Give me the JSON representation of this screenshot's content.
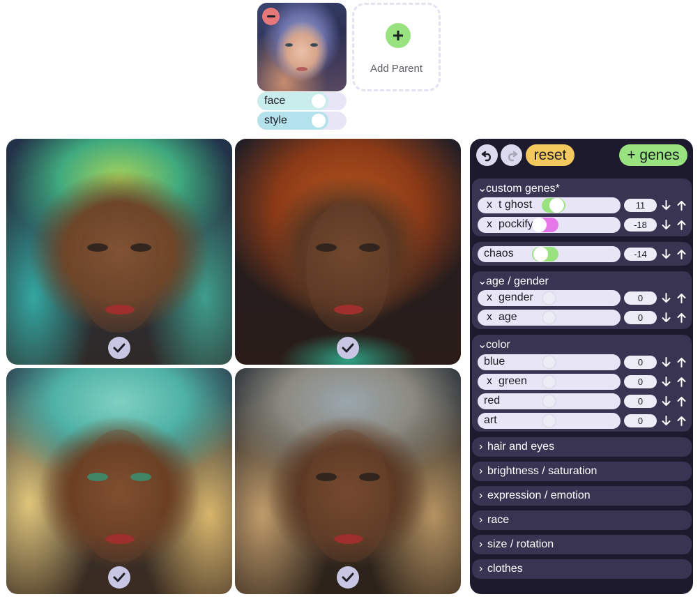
{
  "parent": {
    "add_label": "Add Parent",
    "sliders": [
      {
        "label": "face",
        "level": 0.8
      },
      {
        "label": "style",
        "level": 0.8
      }
    ]
  },
  "panel": {
    "reset_label": "reset",
    "genes_label": "+ genes",
    "groups": {
      "custom": {
        "title": "custom genes*",
        "rows": [
          {
            "x": "x",
            "name": "t ghost",
            "value": "11"
          },
          {
            "x": "x",
            "name": "pockify",
            "value": "-18"
          }
        ]
      },
      "chaos": {
        "name": "chaos",
        "value": "-14"
      },
      "age": {
        "title": "age / gender",
        "rows": [
          {
            "x": "x",
            "name": "gender",
            "value": "0"
          },
          {
            "x": "x",
            "name": "age",
            "value": "0"
          }
        ]
      },
      "color": {
        "title": "color",
        "rows": [
          {
            "name": "blue",
            "value": "0"
          },
          {
            "x": "x",
            "name": "green",
            "value": "0"
          },
          {
            "name": "red",
            "value": "0"
          },
          {
            "name": "art",
            "value": "0"
          }
        ]
      }
    },
    "collapsed": [
      "hair and eyes",
      "brightness / saturation",
      "expression / emotion",
      "race",
      "size / rotation",
      "clothes"
    ]
  },
  "colors": {
    "panel_bg": "#1d1a2e",
    "group_bg": "#393452",
    "reset": "#f3c95e",
    "genes": "#98e37f",
    "remove": "#e7787a",
    "toggle_green": "#98e37f",
    "toggle_pink": "#e577e8"
  }
}
